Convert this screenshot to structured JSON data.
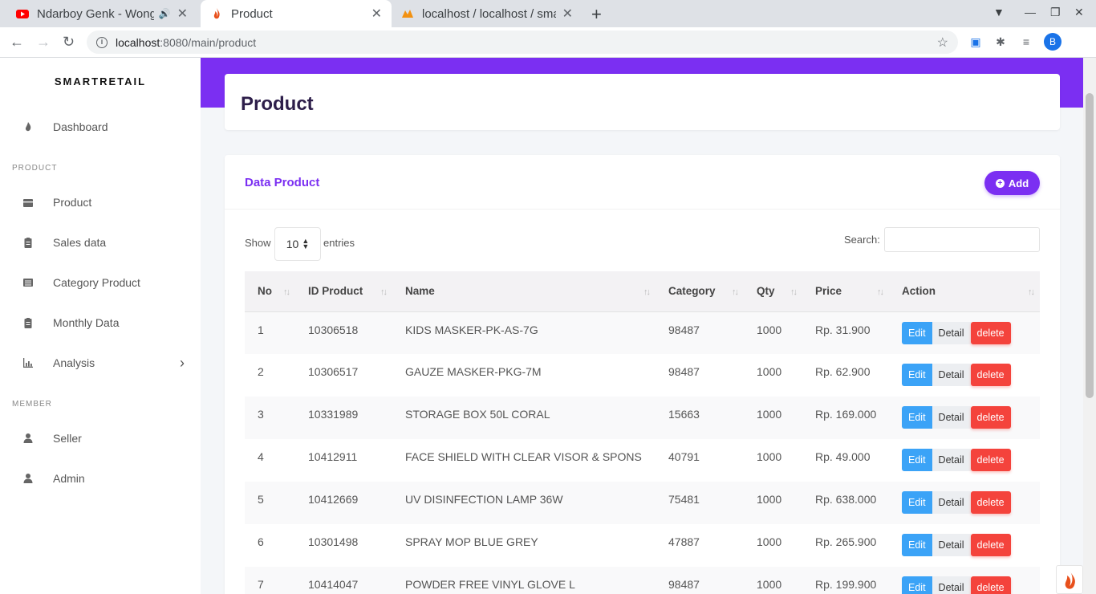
{
  "browser": {
    "tabs": [
      {
        "title": "Ndarboy Genk - Wong"
      },
      {
        "title": "Product"
      },
      {
        "title": "localhost / localhost / sma"
      }
    ],
    "url_host": "localhost",
    "url_path": ":8080/main/product",
    "avatar_letter": "B"
  },
  "sidebar": {
    "brand": "SMARTRETAIL",
    "dashboard": "Dashboard",
    "section_product": "PRODUCT",
    "items": [
      "Product",
      "Sales data",
      "Category Product",
      "Monthly Data",
      "Analysis"
    ],
    "section_member": "MEMBER",
    "members": [
      "Seller",
      "Admin"
    ]
  },
  "header": {
    "title": "Product"
  },
  "card": {
    "title": "Data Product",
    "add_label": "Add",
    "show_label": "Show",
    "entries_value": "10",
    "entries_label": "entries",
    "search_label": "Search:"
  },
  "table": {
    "columns": [
      "No",
      "ID Product",
      "Name",
      "Category",
      "Qty",
      "Price",
      "Action"
    ],
    "rows": [
      {
        "no": "1",
        "id": "10306518",
        "name": "KIDS MASKER-PK-AS-7G",
        "category": "98487",
        "qty": "1000",
        "price": "Rp. 31.900"
      },
      {
        "no": "2",
        "id": "10306517",
        "name": "GAUZE MASKER-PKG-7M",
        "category": "98487",
        "qty": "1000",
        "price": "Rp. 62.900"
      },
      {
        "no": "3",
        "id": "10331989",
        "name": "STORAGE BOX 50L CORAL",
        "category": "15663",
        "qty": "1000",
        "price": "Rp. 169.000"
      },
      {
        "no": "4",
        "id": "10412911",
        "name": "FACE SHIELD WITH CLEAR VISOR & SPONS",
        "category": "40791",
        "qty": "1000",
        "price": "Rp. 49.000"
      },
      {
        "no": "5",
        "id": "10412669",
        "name": "UV DISINFECTION LAMP 36W",
        "category": "75481",
        "qty": "1000",
        "price": "Rp. 638.000"
      },
      {
        "no": "6",
        "id": "10301498",
        "name": "SPRAY MOP BLUE GREY",
        "category": "47887",
        "qty": "1000",
        "price": "Rp. 265.900"
      },
      {
        "no": "7",
        "id": "10414047",
        "name": "POWDER FREE VINYL GLOVE L",
        "category": "98487",
        "qty": "1000",
        "price": "Rp. 199.900"
      }
    ],
    "btn_edit": "Edit",
    "btn_detail": "Detail",
    "btn_delete": "delete"
  },
  "colors": {
    "accent": "#7b2ff2",
    "edit": "#3ba3f7",
    "delete": "#f4433c"
  }
}
